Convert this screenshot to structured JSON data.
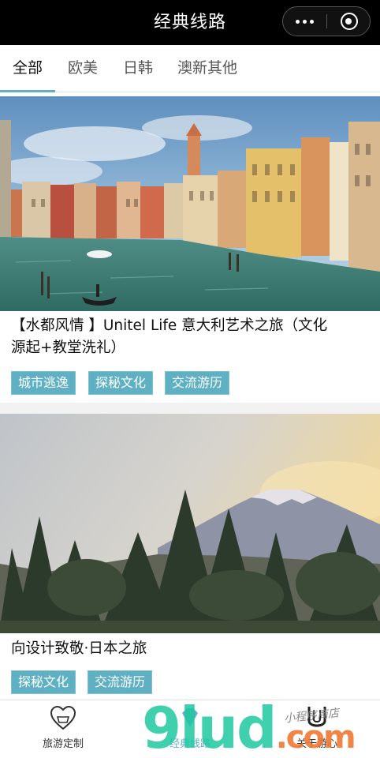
{
  "navbar": {
    "title": "经典线路"
  },
  "tabs": [
    {
      "label": "全部",
      "active": true
    },
    {
      "label": "欧美",
      "active": false
    },
    {
      "label": "日韩",
      "active": false
    },
    {
      "label": "澳新其他",
      "active": false
    }
  ],
  "cards": [
    {
      "image": "venice-canal-photo",
      "title_line1": "【水都风情 】Unitel Life 意大利艺术之旅（文化",
      "title_line2": "源起+教堂洗礼）",
      "tags": [
        "城市逃逸",
        "探秘文化",
        "交流游历"
      ]
    },
    {
      "image": "mount-fuji-photo",
      "title_line1": "向设计致敬·日本之旅",
      "tags": [
        "探秘文化",
        "交流游历"
      ]
    }
  ],
  "tabbar": [
    {
      "label": "旅游定制",
      "icon": "heart-badge-icon",
      "active": false
    },
    {
      "label": "经典线路",
      "icon": "diamond-icon",
      "active": true
    },
    {
      "label": "关于游心",
      "icon": "u-logo-icon",
      "active": false
    }
  ],
  "watermark": {
    "main": "9lud",
    "suffix": ".com",
    "sub": "小程序商店"
  },
  "colors": {
    "accent": "#5eb0c2",
    "navbar": "#000000"
  }
}
